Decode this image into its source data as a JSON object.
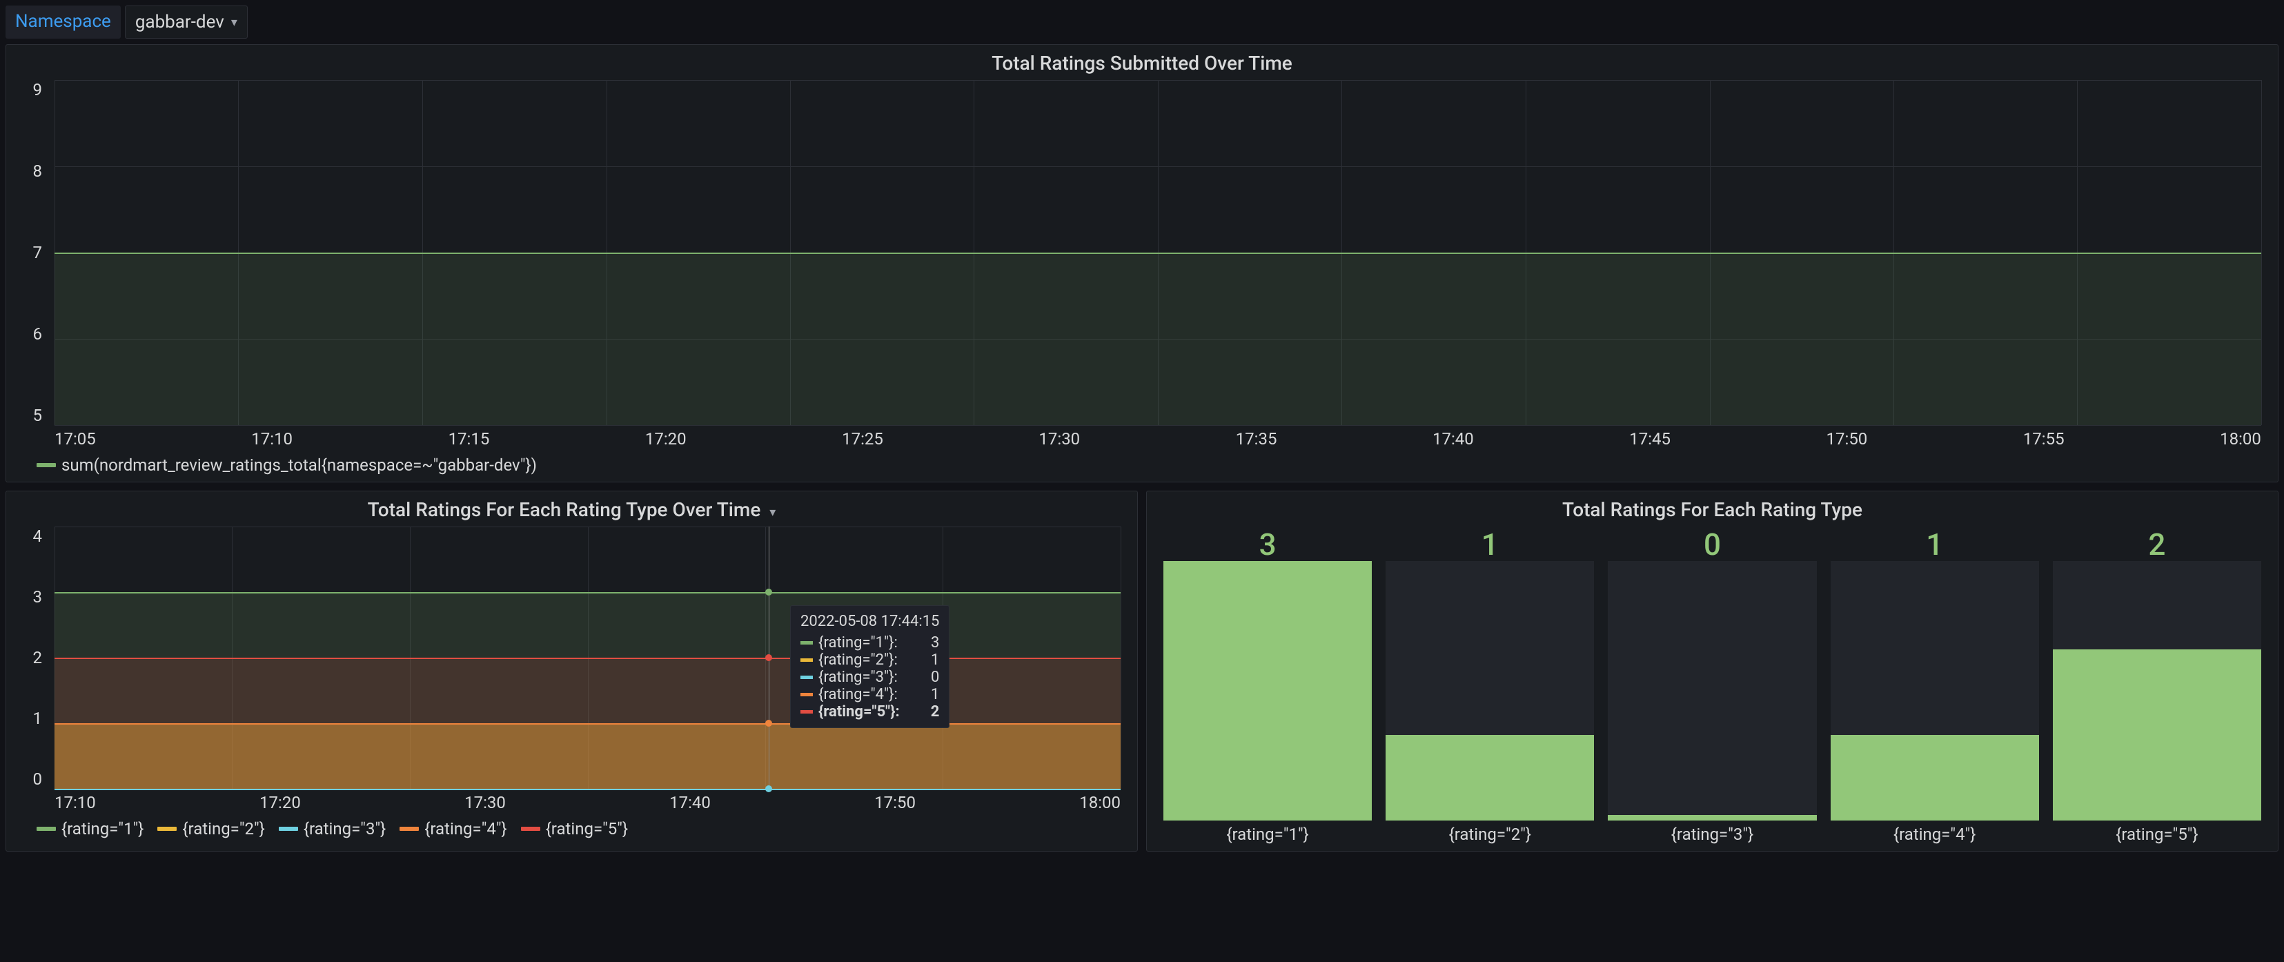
{
  "toolbar": {
    "namespace_label": "Namespace",
    "namespace_value": "gabbar-dev"
  },
  "panel1": {
    "title": "Total Ratings Submitted Over Time",
    "legend_label": "sum(nordmart_review_ratings_total{namespace=~\"gabbar-dev\"})",
    "y_ticks": [
      "9",
      "8",
      "7",
      "6",
      "5"
    ],
    "x_ticks": [
      "17:05",
      "17:10",
      "17:15",
      "17:20",
      "17:25",
      "17:30",
      "17:35",
      "17:40",
      "17:45",
      "17:50",
      "17:55",
      "18:00"
    ]
  },
  "panel2": {
    "title": "Total Ratings For Each Rating Type Over Time",
    "y_ticks": [
      "4",
      "3",
      "2",
      "1",
      "0"
    ],
    "x_ticks": [
      "17:10",
      "17:20",
      "17:30",
      "17:40",
      "17:50",
      "18:00"
    ],
    "legend": [
      {
        "label": "{rating=\"1\"}",
        "color": "#7eb26d"
      },
      {
        "label": "{rating=\"2\"}",
        "color": "#eab839"
      },
      {
        "label": "{rating=\"3\"}",
        "color": "#6ed0e0"
      },
      {
        "label": "{rating=\"4\"}",
        "color": "#ef843c"
      },
      {
        "label": "{rating=\"5\"}",
        "color": "#e24d42"
      }
    ],
    "tooltip": {
      "time": "2022-05-08 17:44:15",
      "rows": [
        {
          "label": "{rating=\"1\"}:",
          "value": "3",
          "color": "#7eb26d"
        },
        {
          "label": "{rating=\"2\"}:",
          "value": "1",
          "color": "#eab839"
        },
        {
          "label": "{rating=\"3\"}:",
          "value": "0",
          "color": "#6ed0e0"
        },
        {
          "label": "{rating=\"4\"}:",
          "value": "1",
          "color": "#ef843c"
        },
        {
          "label": "{rating=\"5\"}:",
          "value": "2",
          "color": "#e24d42",
          "bold": true
        }
      ]
    }
  },
  "panel3": {
    "title": "Total Ratings For Each Rating Type",
    "bars": [
      {
        "value": "3",
        "label": "{rating=\"1\"}",
        "pct": 100
      },
      {
        "value": "1",
        "label": "{rating=\"2\"}",
        "pct": 33
      },
      {
        "value": "0",
        "label": "{rating=\"3\"}",
        "pct": 2
      },
      {
        "value": "1",
        "label": "{rating=\"4\"}",
        "pct": 33
      },
      {
        "value": "2",
        "label": "{rating=\"5\"}",
        "pct": 66
      }
    ]
  },
  "colors": {
    "green": "#7eb26d",
    "bar_green": "#92c779"
  },
  "chart_data": [
    {
      "type": "area",
      "title": "Total Ratings Submitted Over Time",
      "xlabel": "",
      "ylabel": "",
      "ylim": [
        5,
        9
      ],
      "x": [
        "17:05",
        "17:10",
        "17:15",
        "17:20",
        "17:25",
        "17:30",
        "17:35",
        "17:40",
        "17:45",
        "17:50",
        "17:55",
        "18:00"
      ],
      "series": [
        {
          "name": "sum(nordmart_review_ratings_total{namespace=~\"gabbar-dev\"})",
          "values": [
            7,
            7,
            7,
            7,
            7,
            7,
            7,
            7,
            7,
            7,
            7,
            7
          ],
          "color": "#7eb26d"
        }
      ]
    },
    {
      "type": "line",
      "title": "Total Ratings For Each Rating Type Over Time",
      "xlabel": "",
      "ylabel": "",
      "ylim": [
        0,
        4
      ],
      "x": [
        "17:10",
        "17:20",
        "17:30",
        "17:40",
        "17:50",
        "18:00"
      ],
      "series": [
        {
          "name": "{rating=\"1\"}",
          "values": [
            3,
            3,
            3,
            3,
            3,
            3
          ],
          "color": "#7eb26d"
        },
        {
          "name": "{rating=\"2\"}",
          "values": [
            1,
            1,
            1,
            1,
            1,
            1
          ],
          "color": "#eab839"
        },
        {
          "name": "{rating=\"3\"}",
          "values": [
            0,
            0,
            0,
            0,
            0,
            0
          ],
          "color": "#6ed0e0"
        },
        {
          "name": "{rating=\"4\"}",
          "values": [
            1,
            1,
            1,
            1,
            1,
            1
          ],
          "color": "#ef843c"
        },
        {
          "name": "{rating=\"5\"}",
          "values": [
            2,
            2,
            2,
            2,
            2,
            2
          ],
          "color": "#e24d42"
        }
      ],
      "hover": {
        "x": "17:44:15",
        "date": "2022-05-08"
      }
    },
    {
      "type": "bar",
      "title": "Total Ratings For Each Rating Type",
      "categories": [
        "{rating=\"1\"}",
        "{rating=\"2\"}",
        "{rating=\"3\"}",
        "{rating=\"4\"}",
        "{rating=\"5\"}"
      ],
      "values": [
        3,
        1,
        0,
        1,
        2
      ],
      "color": "#92c779"
    }
  ]
}
